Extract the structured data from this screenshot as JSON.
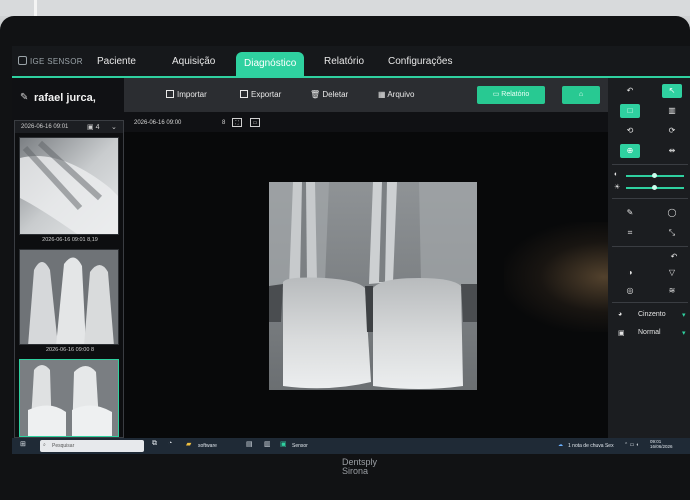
{
  "app": {
    "brand": "IGE SENSOR",
    "tabs": [
      {
        "label": "Paciente",
        "active": false
      },
      {
        "label": "Aquisição",
        "active": false
      },
      {
        "label": "Diagnóstico",
        "active": true
      },
      {
        "label": "Relatório",
        "active": false
      },
      {
        "label": "Configurações",
        "active": false
      }
    ],
    "accent_color": "#2fd1a0"
  },
  "patient": {
    "name": "rafael jurca,"
  },
  "thumbnails": {
    "header_date": "2026-06-16 09:01",
    "header_count": "4",
    "items": [
      {
        "caption": "2026-06-16 09:01  8,19",
        "selected": false
      },
      {
        "caption": "2026-06-16 09:00  8",
        "selected": false
      },
      {
        "caption": "",
        "selected": true
      }
    ]
  },
  "toolbar": {
    "importar": "Importar",
    "exportar": "Exportar",
    "deletar": "Deletar",
    "arquivo": "Arquivo",
    "relatorio": "Relatório"
  },
  "image_info": {
    "datetime": "2026-06-16 09:00",
    "number": "8"
  },
  "right_panel": {
    "color_mode": "Cinzento",
    "filter": "Normal"
  },
  "taskbar": {
    "search_placeholder": "Pesquisar",
    "app1": "software",
    "app2": "Sensor",
    "notification": "1 nota de chuva Sex",
    "time": "09:01",
    "date": "16/06/2026"
  },
  "hardware": {
    "logo_line1": "Dentsply",
    "logo_line2": "Sirona"
  }
}
